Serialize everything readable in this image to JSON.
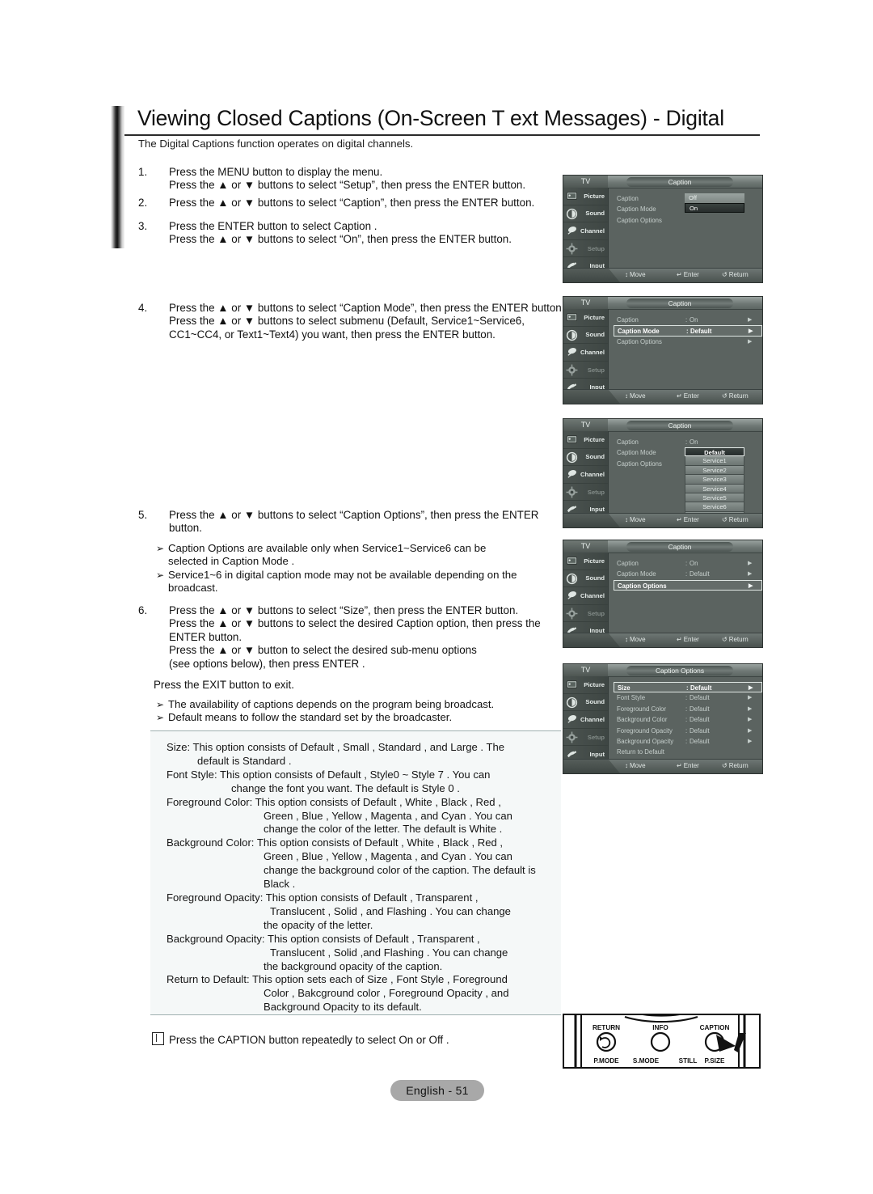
{
  "page": {
    "title": "Viewing Closed Captions (On-Screen T  ext Messages) - Digital",
    "intro": "The Digital Captions function operates on digital channels.",
    "footer_badge": "English - 51"
  },
  "steps": [
    {
      "num": "1.",
      "lines": [
        "Press the MENU button to display the menu.",
        "Press the ▲ or ▼ buttons to select “Setup”, then press the ENTER button."
      ]
    },
    {
      "num": "2.",
      "lines": [
        "Press the ▲ or ▼ buttons to select “Caption”, then press the ENTER button."
      ]
    },
    {
      "num": "3.",
      "lines": [
        "Press the ENTER button to select  Caption .",
        "Press the ▲ or ▼ buttons to select “On”, then press the ENTER button."
      ]
    },
    {
      "num": "4.",
      "lines": [
        "Press the ▲ or ▼ buttons to select “Caption Mode”, then press the ENTER button.",
        "Press the ▲ or ▼ buttons to select submenu (Default, Service1~Service6,",
        "CC1~CC4, or Text1~Text4) you want, then press the ENTER button."
      ]
    },
    {
      "num": "5.",
      "lines": [
        "Press the ▲ or ▼ buttons to select “Caption Options”, then press the ENTER",
        "button."
      ]
    },
    {
      "num": "6.",
      "lines": [
        "Press the ▲ or ▼ buttons to select “Size”, then press the ENTER button.",
        "Press the ▲ or ▼ buttons to select the desired Caption option, then press the",
        "ENTER button.",
        "Press the ▲ or ▼ button to select the desired sub-menu options",
        "(see options below), then press ENTER ."
      ]
    }
  ],
  "notes_after_5": [
    {
      "first": "Caption Options  are available only when  Service1~Service6  can be",
      "cont": "selected in  Caption Mode ."
    },
    {
      "first": "Service1~6 in digital caption mode may not be available depending on the",
      "cont": "broadcast."
    }
  ],
  "exit_line": "Press the EXIT button to exit.",
  "notes_after_6": [
    {
      "first": "The availability of captions depends on the program being broadcast.",
      "cont": ""
    },
    {
      "first": "Default  means to follow the standard set by the broadcaster.",
      "cont": ""
    }
  ],
  "options_box": [
    {
      "indent": 0,
      "text": "Size: This option consists of  Default ,  Small ,  Standard , and  Large . The"
    },
    {
      "indent": 1,
      "text": "default is  Standard ."
    },
    {
      "indent": 0,
      "text": "Font Style:  This option consists of  Default ,  Style0 ~ Style 7 . You can"
    },
    {
      "indent": 2,
      "text": "change the font you want. The default is  Style 0 ."
    },
    {
      "indent": 0,
      "text": "Foreground Color:   This option consists of  Default ,  White ,  Black ,  Red ,"
    },
    {
      "indent": 3,
      "text": "Green ,  Blue ,  Yellow ,  Magenta , and  Cyan . You can"
    },
    {
      "indent": 3,
      "text": "change the color of the letter. The default is  White ."
    },
    {
      "indent": 0,
      "text": "Background Color:   This option consists of  Default ,  White ,  Black ,  Red ,"
    },
    {
      "indent": 3,
      "text": "Green ,  Blue ,  Yellow ,  Magenta , and  Cyan . You can"
    },
    {
      "indent": 3,
      "text": "change the background color of the caption. The default is"
    },
    {
      "indent": 3,
      "text": "Black ."
    },
    {
      "indent": 0,
      "text": "Foreground  Opacity: This option consists of  Default ,  Transparent ,"
    },
    {
      "indent": 4,
      "text": "Translucent ,  Solid , and  Flashing . You can change"
    },
    {
      "indent": 3,
      "text": "the opacity of the letter."
    },
    {
      "indent": 0,
      "text": "Background  Opacity: This option consists of  Default ,  Transparent ,"
    },
    {
      "indent": 4,
      "text": "Translucent ,  Solid ,and  Flashing . You can change"
    },
    {
      "indent": 3,
      "text": "the background opacity of the caption."
    },
    {
      "indent": 0,
      "text": "Return to  Default: This option sets each of  Size ,  Font Style ,  Foreground"
    },
    {
      "indent": 3,
      "text": "Color ,  Bakcground color ,  Foreground Opacity , and"
    },
    {
      "indent": 3,
      "text": "Background Opacity  to its default."
    }
  ],
  "caption_note": "Press the CAPTION button repeatedly to select  On  or  Off .",
  "osd": {
    "sidebar": [
      {
        "label": "Picture",
        "icon": "picture-icon",
        "dim": false
      },
      {
        "label": "Sound",
        "icon": "sound-icon",
        "dim": false
      },
      {
        "label": "Channel",
        "icon": "channel-icon",
        "dim": false
      },
      {
        "label": "Setup",
        "icon": "setup-icon",
        "dim": true
      },
      {
        "label": "Input",
        "icon": "input-icon",
        "dim": false
      }
    ],
    "tv_label": "TV",
    "footer": [
      {
        "glyph": "↕",
        "label": "Move"
      },
      {
        "glyph": "↵",
        "label": "Enter"
      },
      {
        "glyph": "↺",
        "label": "Return"
      }
    ],
    "panels": [
      {
        "title": "Caption",
        "rows": [
          {
            "label": "Caption",
            "colon": ":",
            "value": "",
            "arrow": "",
            "selected": false
          },
          {
            "label": "Caption Mode",
            "colon": ":",
            "value": "",
            "arrow": "",
            "selected": false
          },
          {
            "label": "Caption Options",
            "colon": "",
            "value": "",
            "arrow": "",
            "selected": false
          }
        ],
        "popup": {
          "off": "Off",
          "on": "On"
        }
      },
      {
        "title": "Caption",
        "rows": [
          {
            "label": "Caption",
            "colon": ":",
            "value": "On",
            "arrow": "▶",
            "selected": false
          },
          {
            "label": "Caption Mode",
            "colon": ":",
            "value": "Default",
            "arrow": "▶",
            "selected": true
          },
          {
            "label": "Caption Options",
            "colon": "",
            "value": "",
            "arrow": "▶",
            "selected": false
          }
        ]
      },
      {
        "title": "Caption",
        "rows": [
          {
            "label": "Caption",
            "colon": ":",
            "value": "On",
            "arrow": "",
            "selected": false
          },
          {
            "label": "Caption Mode",
            "colon": ":",
            "value": "",
            "arrow": "",
            "selected": false
          },
          {
            "label": "Caption Options",
            "colon": ":",
            "value": "",
            "arrow": "",
            "selected": false
          }
        ],
        "dropdown": [
          "Default",
          "Service1",
          "Service2",
          "Service3",
          "Service4",
          "Service5",
          "Service6",
          "▼"
        ]
      },
      {
        "title": "Caption",
        "rows": [
          {
            "label": "Caption",
            "colon": ":",
            "value": "On",
            "arrow": "▶",
            "selected": false
          },
          {
            "label": "Caption Mode",
            "colon": ":",
            "value": "Default",
            "arrow": "▶",
            "selected": false
          },
          {
            "label": "Caption Options",
            "colon": "",
            "value": "",
            "arrow": "▶",
            "selected": true
          }
        ]
      },
      {
        "title": "Caption Options",
        "rows": [
          {
            "label": "Size",
            "colon": ":",
            "value": "Default",
            "arrow": "▶",
            "selected": true
          },
          {
            "label": "Font Style",
            "colon": ":",
            "value": "Default",
            "arrow": "▶",
            "selected": false
          },
          {
            "label": "Foreground Color",
            "colon": ":",
            "value": "Default",
            "arrow": "▶",
            "selected": false
          },
          {
            "label": "Background Color",
            "colon": ":",
            "value": "Default",
            "arrow": "▶",
            "selected": false
          },
          {
            "label": "Foreground Opacity",
            "colon": ":",
            "value": "Default",
            "arrow": "▶",
            "selected": false
          },
          {
            "label": "Background  Opacity",
            "colon": ":",
            "value": "Default",
            "arrow": "▶",
            "selected": false
          },
          {
            "label": "Return to Default",
            "colon": "",
            "value": "",
            "arrow": "",
            "selected": false
          }
        ]
      }
    ]
  },
  "remote": {
    "buttons_top": [
      "RETURN",
      "INFO",
      "CAPTION"
    ],
    "buttons_bottom": [
      "P.MODE",
      "S.MODE",
      "STILL",
      "P.SIZE"
    ]
  }
}
